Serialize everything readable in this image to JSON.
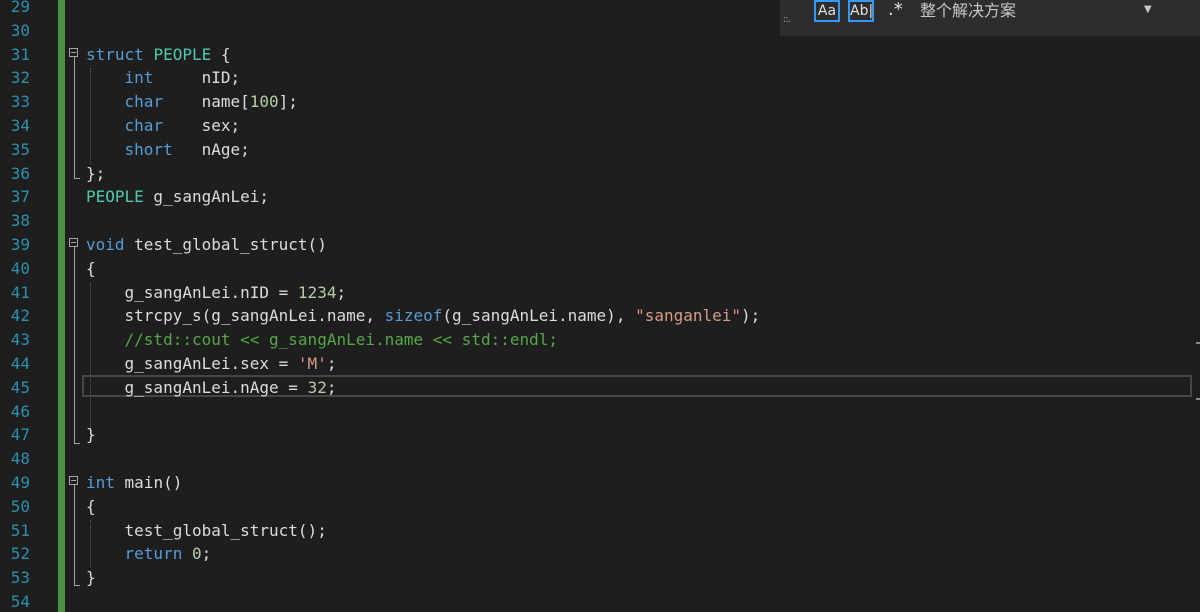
{
  "editor": {
    "line_numbers": [
      "29",
      "30",
      "31",
      "32",
      "33",
      "34",
      "35",
      "36",
      "37",
      "38",
      "39",
      "40",
      "41",
      "42",
      "43",
      "44",
      "45",
      "46",
      "47",
      "48",
      "49",
      "50",
      "51",
      "52",
      "53",
      "54"
    ],
    "lines": {
      "l31": [
        {
          "c": "kw",
          "t": "struct"
        },
        {
          "c": "",
          "t": " "
        },
        {
          "c": "type",
          "t": "PEOPLE"
        },
        {
          "c": "",
          "t": " {"
        }
      ],
      "l32": [
        {
          "c": "",
          "t": "    "
        },
        {
          "c": "kw",
          "t": "int"
        },
        {
          "c": "",
          "t": "     nID;"
        }
      ],
      "l33": [
        {
          "c": "",
          "t": "    "
        },
        {
          "c": "kw",
          "t": "char"
        },
        {
          "c": "",
          "t": "    name["
        },
        {
          "c": "num",
          "t": "100"
        },
        {
          "c": "",
          "t": "];"
        }
      ],
      "l34": [
        {
          "c": "",
          "t": "    "
        },
        {
          "c": "kw",
          "t": "char"
        },
        {
          "c": "",
          "t": "    sex;"
        }
      ],
      "l35": [
        {
          "c": "",
          "t": "    "
        },
        {
          "c": "kw",
          "t": "short"
        },
        {
          "c": "",
          "t": "   nAge;"
        }
      ],
      "l36": [
        {
          "c": "",
          "t": "};"
        }
      ],
      "l37": [
        {
          "c": "type",
          "t": "PEOPLE"
        },
        {
          "c": "",
          "t": " g_sangAnLei;"
        }
      ],
      "l39": [
        {
          "c": "kw",
          "t": "void"
        },
        {
          "c": "",
          "t": " test_global_struct()"
        }
      ],
      "l40": [
        {
          "c": "",
          "t": "{"
        }
      ],
      "l41": [
        {
          "c": "",
          "t": "    g_sangAnLei.nID = "
        },
        {
          "c": "num",
          "t": "1234"
        },
        {
          "c": "",
          "t": ";"
        }
      ],
      "l42": [
        {
          "c": "",
          "t": "    strcpy_s(g_sangAnLei.name, "
        },
        {
          "c": "kw",
          "t": "sizeof"
        },
        {
          "c": "",
          "t": "(g_sangAnLei.name), "
        },
        {
          "c": "str",
          "t": "\"sanganlei\""
        },
        {
          "c": "",
          "t": ");"
        }
      ],
      "l43": [
        {
          "c": "",
          "t": "    "
        },
        {
          "c": "cmt",
          "t": "//std::cout << g_sangAnLei.name << std::endl;"
        }
      ],
      "l44": [
        {
          "c": "",
          "t": "    g_sangAnLei.sex = "
        },
        {
          "c": "str",
          "t": "'M'"
        },
        {
          "c": "",
          "t": ";"
        }
      ],
      "l45": [
        {
          "c": "",
          "t": "    g_sangAnLei.nAge = "
        },
        {
          "c": "num",
          "t": "32"
        },
        {
          "c": "",
          "t": ";"
        }
      ],
      "l47": [
        {
          "c": "",
          "t": "}"
        }
      ],
      "l49": [
        {
          "c": "kw",
          "t": "int"
        },
        {
          "c": "",
          "t": " main()"
        }
      ],
      "l50": [
        {
          "c": "",
          "t": "{"
        }
      ],
      "l51": [
        {
          "c": "",
          "t": "    test_global_struct();"
        }
      ],
      "l52": [
        {
          "c": "",
          "t": "    "
        },
        {
          "c": "kw",
          "t": "return"
        },
        {
          "c": "",
          "t": " "
        },
        {
          "c": "num",
          "t": "0"
        },
        {
          "c": "",
          "t": ";"
        }
      ],
      "l53": [
        {
          "c": "",
          "t": "}"
        }
      ]
    }
  },
  "find_bar": {
    "match_case_label": "Aa",
    "whole_word_label": "Ab|",
    "regex_label": ".*",
    "scope_label": "整个解决方案",
    "dropdown_glyph": "▼",
    "grip_glyph": "::."
  },
  "colors": {
    "keyword": "#569cd6",
    "type": "#4ec9b0",
    "string": "#d69d85",
    "number": "#b5cea8",
    "comment": "#57a64a",
    "line_number": "#2b91af"
  }
}
